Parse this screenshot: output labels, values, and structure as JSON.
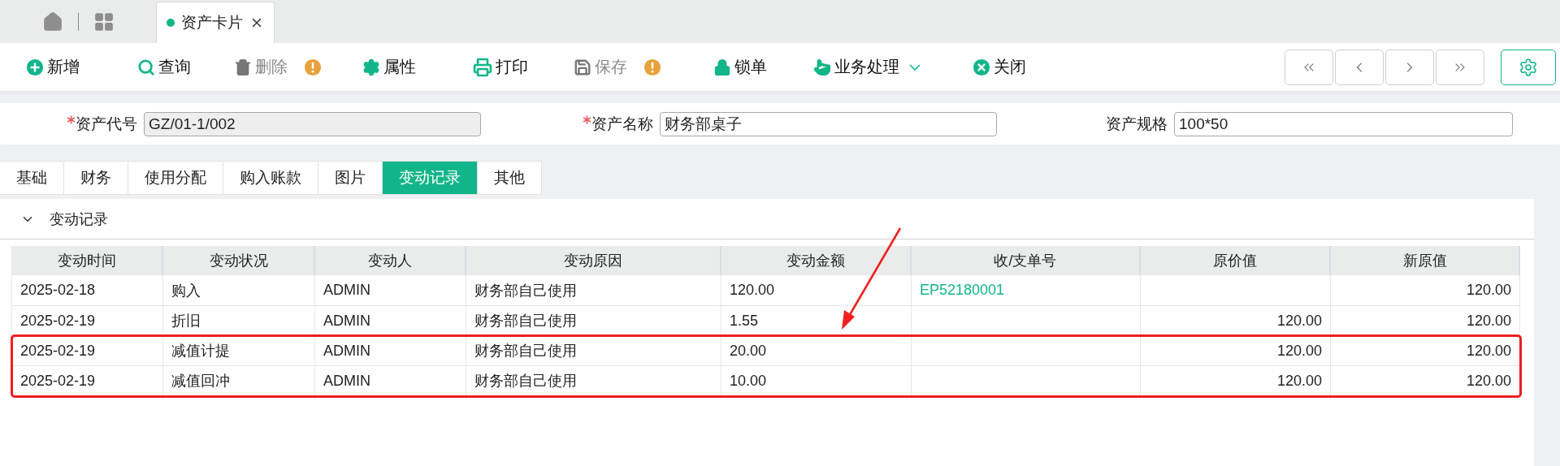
{
  "top_tabs": [
    {
      "kind": "home"
    },
    {
      "kind": "apps"
    },
    {
      "kind": "page",
      "label": "资产卡片",
      "selected": true
    }
  ],
  "toolbar": [
    {
      "kind": "add",
      "label": "新增",
      "disabled": false
    },
    {
      "kind": "search",
      "label": "查询",
      "disabled": false
    },
    {
      "kind": "delete",
      "label": "删除",
      "disabled": true,
      "warning": true
    },
    {
      "kind": "props",
      "label": "属性",
      "disabled": false
    },
    {
      "kind": "print",
      "label": "打印",
      "disabled": false
    },
    {
      "kind": "save",
      "label": "保存",
      "disabled": true,
      "warning": true
    },
    {
      "kind": "lock",
      "label": "锁单",
      "disabled": false
    },
    {
      "kind": "process",
      "label": "业务处理",
      "disabled": false,
      "dropdown": true
    },
    {
      "kind": "close",
      "label": "关闭",
      "disabled": false
    }
  ],
  "nav_buttons": [
    {
      "kind": "first"
    },
    {
      "kind": "prev"
    },
    {
      "kind": "next"
    },
    {
      "kind": "last"
    }
  ],
  "fields": [
    {
      "label": "资产代号",
      "value": "GZ/01-1/002",
      "required": true,
      "readonly": true
    },
    {
      "label": "资产名称",
      "value": "财务部桌子",
      "required": true,
      "readonly": false
    },
    {
      "label": "资产规格",
      "value": "100*50",
      "readonly": false
    }
  ],
  "tabs": [
    {
      "label": "基础",
      "selected": false
    },
    {
      "label": "财务",
      "selected": false
    },
    {
      "label": "使用分配",
      "selected": false
    },
    {
      "label": "购入账款",
      "selected": false
    },
    {
      "label": "图片",
      "selected": false
    },
    {
      "label": "变动记录",
      "selected": true
    },
    {
      "label": "其他",
      "selected": false
    }
  ],
  "section": {
    "title": "变动记录",
    "expanded": true
  },
  "table": {
    "columns": [
      {
        "label": "变动时间",
        "kind": "text"
      },
      {
        "label": "变动状况",
        "kind": "text"
      },
      {
        "label": "变动人",
        "kind": "text"
      },
      {
        "label": "变动原因",
        "kind": "text"
      },
      {
        "label": "变动金额",
        "kind": "text"
      },
      {
        "label": "收/支单号",
        "kind": "link"
      },
      {
        "label": "原价值",
        "kind": "money"
      },
      {
        "label": "新原值",
        "kind": "money"
      }
    ],
    "rows": [
      {
        "cells": [
          "2025-02-18",
          "购入",
          "ADMIN",
          "财务部自己使用",
          "120.00",
          "EP52180001",
          "",
          "120.00"
        ]
      },
      {
        "cells": [
          "2025-02-19",
          "折旧",
          "ADMIN",
          "财务部自己使用",
          "1.55",
          "",
          "120.00",
          "120.00"
        ]
      },
      {
        "cells": [
          "2025-02-19",
          "减值计提",
          "ADMIN",
          "财务部自己使用",
          "20.00",
          "",
          "120.00",
          "120.00"
        ],
        "highlighted": true
      },
      {
        "cells": [
          "2025-02-19",
          "减值回冲",
          "ADMIN",
          "财务部自己使用",
          "10.00",
          "",
          "120.00",
          "120.00"
        ],
        "highlighted": true
      }
    ]
  },
  "annotation": {
    "arrow": true
  }
}
